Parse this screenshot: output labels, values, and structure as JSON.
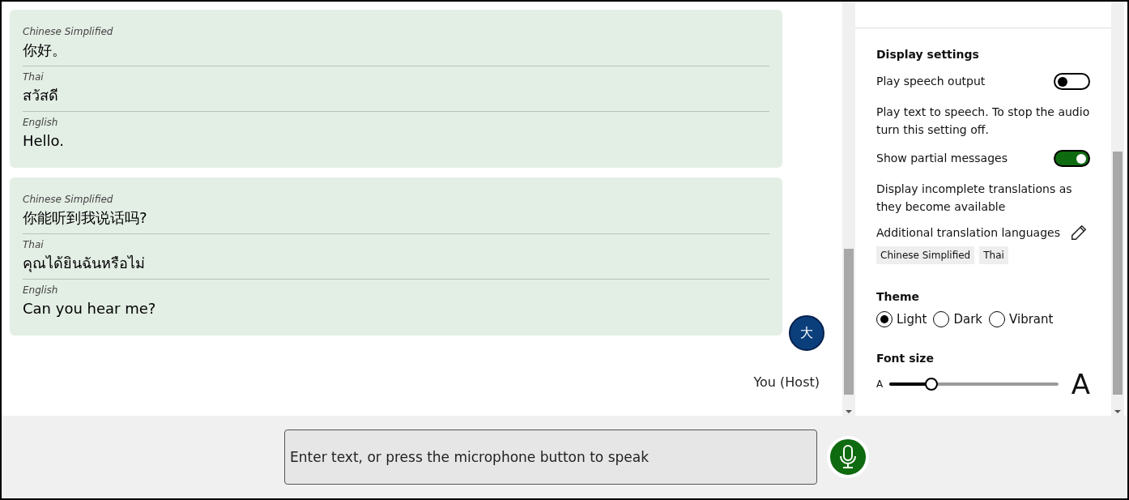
{
  "messages": [
    {
      "translations": [
        {
          "language": "Chinese Simplified",
          "text": "你好。"
        },
        {
          "language": "Thai",
          "text": "สวัสดี"
        },
        {
          "language": "English",
          "text": "Hello."
        }
      ]
    },
    {
      "translations": [
        {
          "language": "Chinese Simplified",
          "text": "你能听到我说话吗?"
        },
        {
          "language": "Thai",
          "text": "คุณได้ยินฉันหรือไม่"
        },
        {
          "language": "English",
          "text": "Can you hear me?"
        }
      ]
    }
  ],
  "sender": {
    "avatar": "大",
    "name": "You (Host)"
  },
  "settings": {
    "heading": "Display settings",
    "toggles": [
      {
        "label": "Play speech output",
        "on": false,
        "description": "Play text to speech. To stop the audio turn this setting off."
      },
      {
        "label": "Show partial messages",
        "on": true,
        "description": "Display incomplete translations as they become available"
      }
    ],
    "languages": {
      "label": "Additional translation languages",
      "tags": [
        "Chinese Simplified",
        "Thai"
      ]
    },
    "theme": {
      "label": "Theme",
      "options": [
        {
          "label": "Light",
          "selected": true
        },
        {
          "label": "Dark",
          "selected": false
        },
        {
          "label": "Vibrant",
          "selected": false
        }
      ]
    },
    "font_size": {
      "label": "Font size",
      "small": "A",
      "large": "A",
      "level": 0.25
    }
  },
  "composer": {
    "placeholder": "Enter text, or press the microphone button to speak"
  }
}
